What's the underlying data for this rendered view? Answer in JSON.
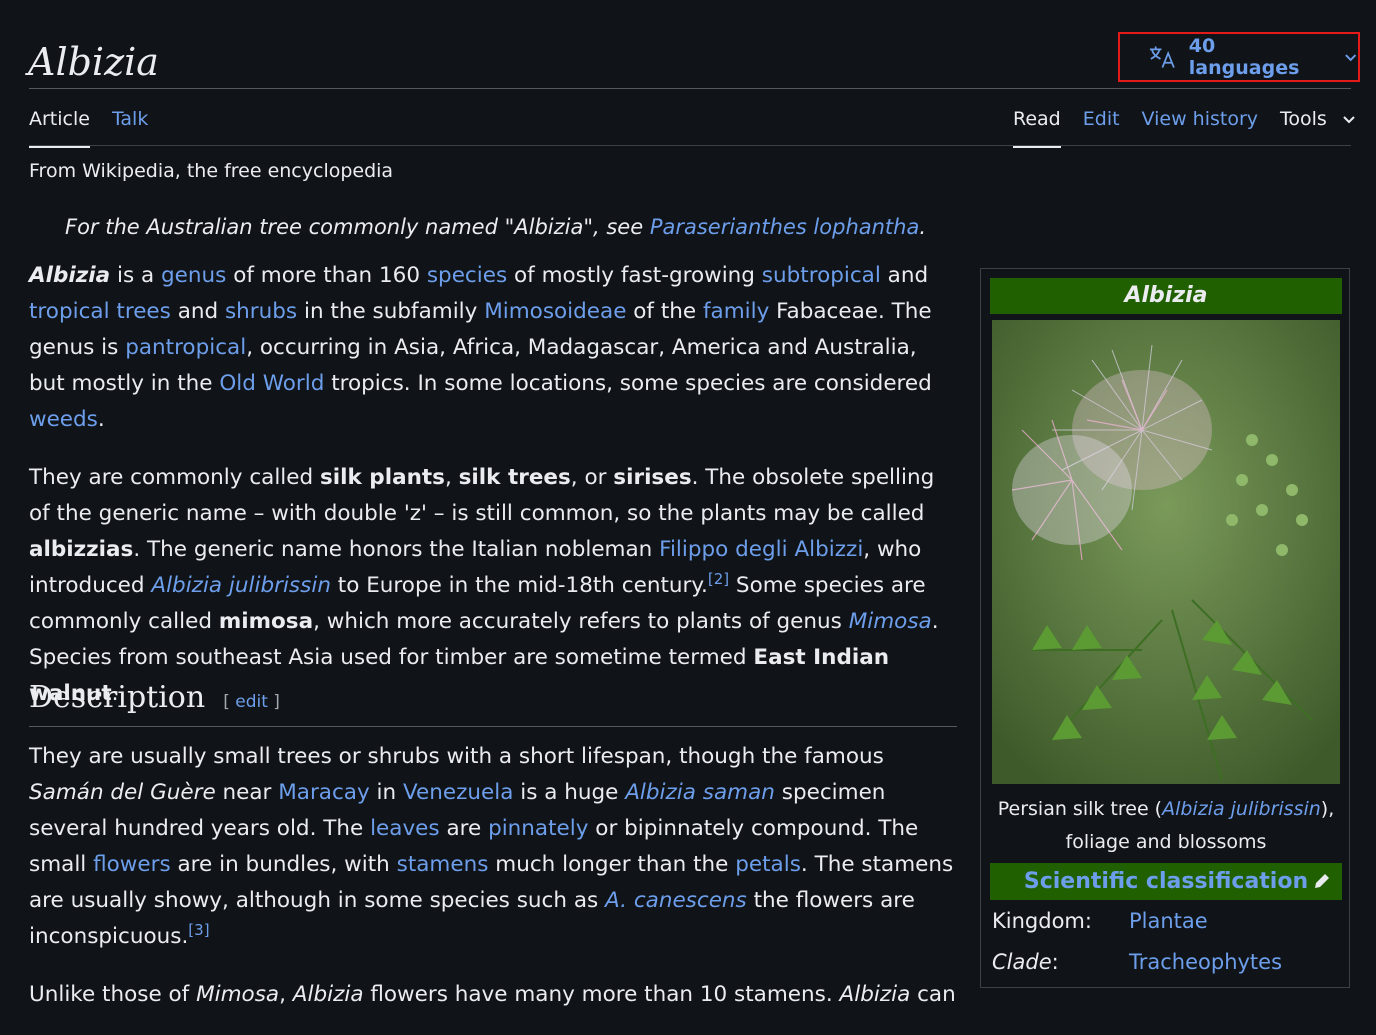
{
  "page": {
    "title": "Albizia",
    "languages_label": "40 languages"
  },
  "tabs": {
    "article": "Article",
    "talk": "Talk",
    "read": "Read",
    "edit": "Edit",
    "history": "View history",
    "tools": "Tools"
  },
  "tagline": "From Wikipedia, the free encyclopedia",
  "hatnote": {
    "prefix": "For the Australian tree commonly named \"Albizia\", see ",
    "link": "Paraserianthes lophantha",
    "suffix": "."
  },
  "para1": {
    "t1": "Albizia",
    "t2": " is a ",
    "l1": "genus",
    "t3": " of more than 160 ",
    "l2": "species",
    "t4": " of mostly fast-growing ",
    "l3": "subtropical",
    "t5": " and ",
    "l4": "tropical",
    "t6": " ",
    "l5": "trees",
    "t7": " and ",
    "l6": "shrubs",
    "t8": " in the subfamily ",
    "l7": "Mimosoideae",
    "t9": " of the ",
    "l8": "family",
    "t10": " Fabaceae. The genus is ",
    "l9": "pantropical",
    "t11": ", occurring in Asia, Africa, Madagascar, America and Australia, but mostly in the ",
    "l10": "Old World",
    "t12": " tropics. In some locations, some species are considered ",
    "l11": "weeds",
    "t13": "."
  },
  "para2": {
    "t1": "They are commonly called ",
    "b1": "silk plants",
    "t2": ", ",
    "b2": "silk trees",
    "t3": ", or ",
    "b3": "sirises",
    "t4": ". The obsolete spelling of the generic name – with double 'z' – is still common, so the plants may be called ",
    "b4": "albizzias",
    "t5": ". The generic name honors the Italian nobleman ",
    "l1": "Filippo degli Albizzi",
    "t6": ", who introduced ",
    "l2": "Albizia julibrissin",
    "t7": " to Europe in the mid-18th century.",
    "ref1": "[2]",
    "t8": " Some species are commonly called ",
    "b5": "mimosa",
    "t9": ", which more accurately refers to plants of genus ",
    "l3": "Mimosa",
    "t10": ". Species from southeast Asia used for timber are sometime termed ",
    "b6": "East Indian walnut",
    "t11": "."
  },
  "section": {
    "title": "Description",
    "edit_open": "[ ",
    "edit": "edit",
    "edit_close": " ]"
  },
  "para3": {
    "t1": "They are usually small trees or shrubs with a short lifespan, though the famous ",
    "i1": "Samán del Guère",
    "t2": " near ",
    "l1": "Maracay",
    "t3": " in ",
    "l2": "Venezuela",
    "t4": " is a huge ",
    "l3": "Albizia saman",
    "t5": " specimen several hundred years old. The ",
    "l4": "leaves",
    "t6": " are ",
    "l5": "pinnately",
    "t7": " or bipinnately compound. The small ",
    "l6": "flowers",
    "t8": " are in bundles, with ",
    "l7": "stamens",
    "t9": " much longer than the ",
    "l8": "petals",
    "t10": ". The stamens are usually showy, although in some species such as ",
    "l9": "A. canescens",
    "t11": " the flowers are inconspicuous.",
    "ref1": "[3]"
  },
  "para4": {
    "t1": "Unlike those of ",
    "i1": "Mimosa",
    "t2": ", ",
    "i2": "Albizia",
    "t3": " flowers have many more than 10 stamens. ",
    "i3": "Albizia",
    "t4": " can"
  },
  "infobox": {
    "title": "Albizia",
    "caption_pre": "Persian silk tree (",
    "caption_link": "Albizia julibrissin",
    "caption_post": "), foliage and blossoms",
    "sci_heading": "Scientific classification",
    "rows": [
      {
        "label": "Kingdom:",
        "value": "Plantae"
      },
      {
        "label": "Clade",
        "label_suffix": ":",
        "value": "Tracheophytes"
      }
    ]
  },
  "colors": {
    "background": "#101418",
    "link": "#6d9eeb",
    "infobox_header": "#206000",
    "highlight_box": "#e21a1a"
  }
}
